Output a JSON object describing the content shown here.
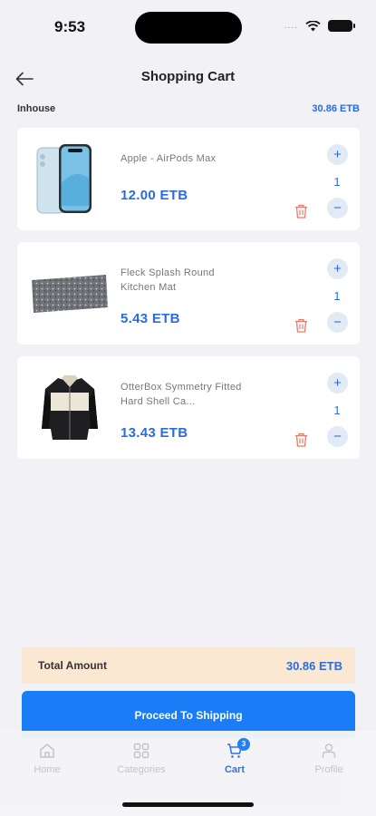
{
  "status_bar": {
    "time": "9:53",
    "signal_dots": "...."
  },
  "header": {
    "title": "Shopping Cart"
  },
  "seller": {
    "name": "Inhouse",
    "total": "30.86 ETB"
  },
  "cart_items": [
    {
      "name": "Apple - AirPods Max",
      "price": "12.00 ETB",
      "quantity": "1",
      "image_icon": "iphone-image"
    },
    {
      "name": "Fleck Splash Round Kitchen Mat",
      "price": "5.43 ETB",
      "quantity": "1",
      "image_icon": "kitchen-mat-image"
    },
    {
      "name": "OtterBox Symmetry Fitted Hard Shell Ca...",
      "price": "13.43 ETB",
      "quantity": "1",
      "image_icon": "jacket-image"
    }
  ],
  "controls": {
    "plus": "+",
    "minus": "−"
  },
  "summary": {
    "label": "Total Amount",
    "value": "30.86 ETB"
  },
  "proceed_button": {
    "label": "Proceed To Shipping"
  },
  "bottom_nav": {
    "items": [
      {
        "label": "Home",
        "icon": "home-icon"
      },
      {
        "label": "Categories",
        "icon": "grid-icon"
      },
      {
        "label": "Cart",
        "icon": "cart-icon",
        "badge": "3"
      },
      {
        "label": "Profile",
        "icon": "user-icon"
      }
    ]
  },
  "colors": {
    "accent": "#2b6be0",
    "button": "#1a7cf7",
    "total_bg": "#fbe8d3",
    "delete": "#e57a6b"
  }
}
